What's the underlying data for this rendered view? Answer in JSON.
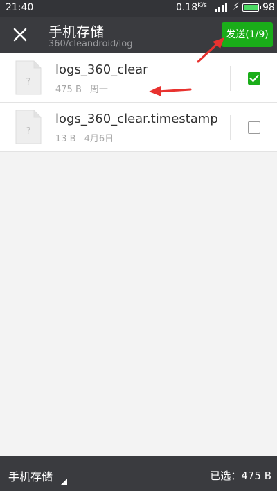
{
  "status_bar": {
    "time": "21:40",
    "network_speed": "0.18",
    "speed_unit": "K/s",
    "battery_percent": "98"
  },
  "header": {
    "title": "手机存储",
    "path": "360/cleandroid/log",
    "send_button": "发送(1/9)"
  },
  "files": [
    {
      "name": "logs_360_clear",
      "size": "475 B",
      "date": "周一",
      "icon_glyph": "?",
      "checked": true
    },
    {
      "name": "logs_360_clear.timestamp",
      "size": "13 B",
      "date": "4月6日",
      "icon_glyph": "?",
      "checked": false
    }
  ],
  "bottom_bar": {
    "storage_label": "手机存储",
    "selected_text": "已选：475 B"
  },
  "colors": {
    "accent_green": "#1aad19",
    "header_bg": "#3a3b3f",
    "annotation_red": "#e8322f"
  }
}
